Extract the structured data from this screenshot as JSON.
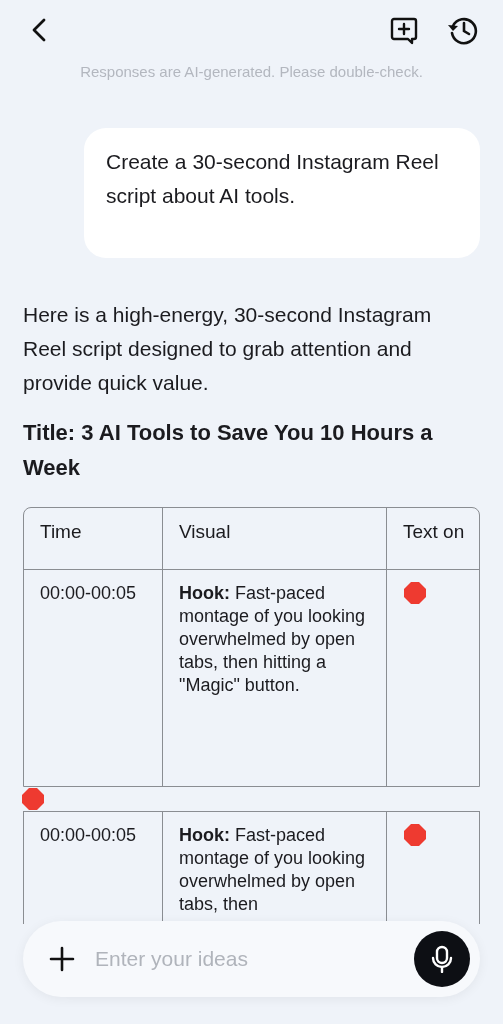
{
  "disclaimer": "Responses are AI-generated. Please double-check.",
  "messages": [
    {
      "kind": "user",
      "text": "Create a 30-second Instagram Reel script about AI tools."
    },
    {
      "kind": "assistant",
      "blocks": [
        {
          "kind": "paragraph",
          "text": "Here is a high-energy, 30-second Instagram Reel script designed to grab attention and provide quick value."
        },
        {
          "kind": "heading",
          "text": "Title: 3 AI Tools to Save You 10 Hours a Week"
        },
        {
          "kind": "table",
          "columns": [
            "Time",
            "Visual",
            "Text on"
          ],
          "rows": [
            [
              {
                "kind": "text",
                "text": "00:00-00:05"
              },
              {
                "kind": "text",
                "text": "**Hook:** Fast-paced montage of you looking overwhelmed by open tabs, then hitting a \"Magic\" button."
              },
              {
                "kind": "icon"
              }
            ]
          ]
        },
        {
          "kind": "icon"
        },
        {
          "kind": "table",
          "rows": [
            [
              {
                "kind": "text",
                "text": "00:00-00:05"
              },
              {
                "kind": "text",
                "text": "**Hook:** Fast-paced montage of you looking overwhelmed by open tabs, then"
              },
              {
                "kind": "icon"
              }
            ]
          ]
        }
      ]
    }
  ],
  "composer": {
    "placeholder": "Enter your ideas"
  }
}
